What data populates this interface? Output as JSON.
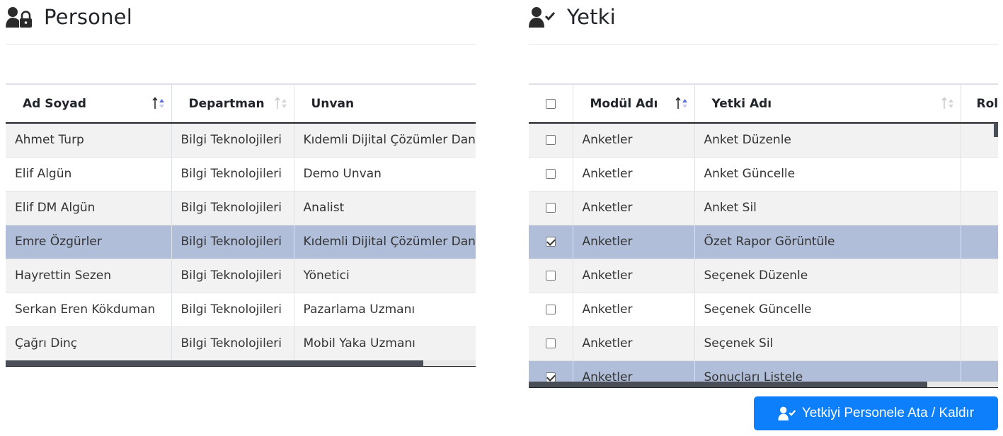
{
  "personel": {
    "title": "Personel",
    "icon": "user-lock-icon",
    "columns": [
      "Ad Soyad",
      "Departman",
      "Unvan"
    ],
    "rows": [
      {
        "name": "Ahmet Turp",
        "dept": "Bilgi Teknolojileri",
        "title": "Kıdemli Dijital Çözümler Danışmanı",
        "selected": false
      },
      {
        "name": "Elif Algün",
        "dept": "Bilgi Teknolojileri",
        "title": "Demo Unvan",
        "selected": false
      },
      {
        "name": "Elif DM Algün",
        "dept": "Bilgi Teknolojileri",
        "title": "Analist",
        "selected": false
      },
      {
        "name": "Emre Özgürler",
        "dept": "Bilgi Teknolojileri",
        "title": "Kıdemli Dijital Çözümler Danışmanı",
        "selected": true
      },
      {
        "name": "Hayrettin Sezen",
        "dept": "Bilgi Teknolojileri",
        "title": "Yönetici",
        "selected": false
      },
      {
        "name": "Serkan Eren Kökduman",
        "dept": "Bilgi Teknolojileri",
        "title": "Pazarlama Uzmanı",
        "selected": false
      },
      {
        "name": "Çağrı Dinç",
        "dept": "Bilgi Teknolojileri",
        "title": "Mobil Yaka Uzmanı",
        "selected": false
      }
    ]
  },
  "yetki": {
    "title": "Yetki",
    "icon": "user-check-icon",
    "columns": [
      "",
      "Modül Adı",
      "Yetki Adı",
      "Rol"
    ],
    "rows": [
      {
        "checked": false,
        "module": "Anketler",
        "perm": "Anket Düzenle",
        "selected": false
      },
      {
        "checked": false,
        "module": "Anketler",
        "perm": "Anket Güncelle",
        "selected": false
      },
      {
        "checked": false,
        "module": "Anketler",
        "perm": "Anket Sil",
        "selected": false
      },
      {
        "checked": true,
        "module": "Anketler",
        "perm": "Özet Rapor Görüntüle",
        "selected": true
      },
      {
        "checked": false,
        "module": "Anketler",
        "perm": "Seçenek Düzenle",
        "selected": false
      },
      {
        "checked": false,
        "module": "Anketler",
        "perm": "Seçenek Güncelle",
        "selected": false
      },
      {
        "checked": false,
        "module": "Anketler",
        "perm": "Seçenek Sil",
        "selected": false
      },
      {
        "checked": true,
        "module": "Anketler",
        "perm": "Sonuçları Listele",
        "selected": true
      }
    ]
  },
  "assign_button": {
    "label": "Yetkiyi Personele Ata / Kaldır",
    "icon": "user-check-icon"
  },
  "colors": {
    "selected_row": "#b0bed9",
    "button": "#0d7ffb",
    "sort_active": "#5b6fd6"
  }
}
